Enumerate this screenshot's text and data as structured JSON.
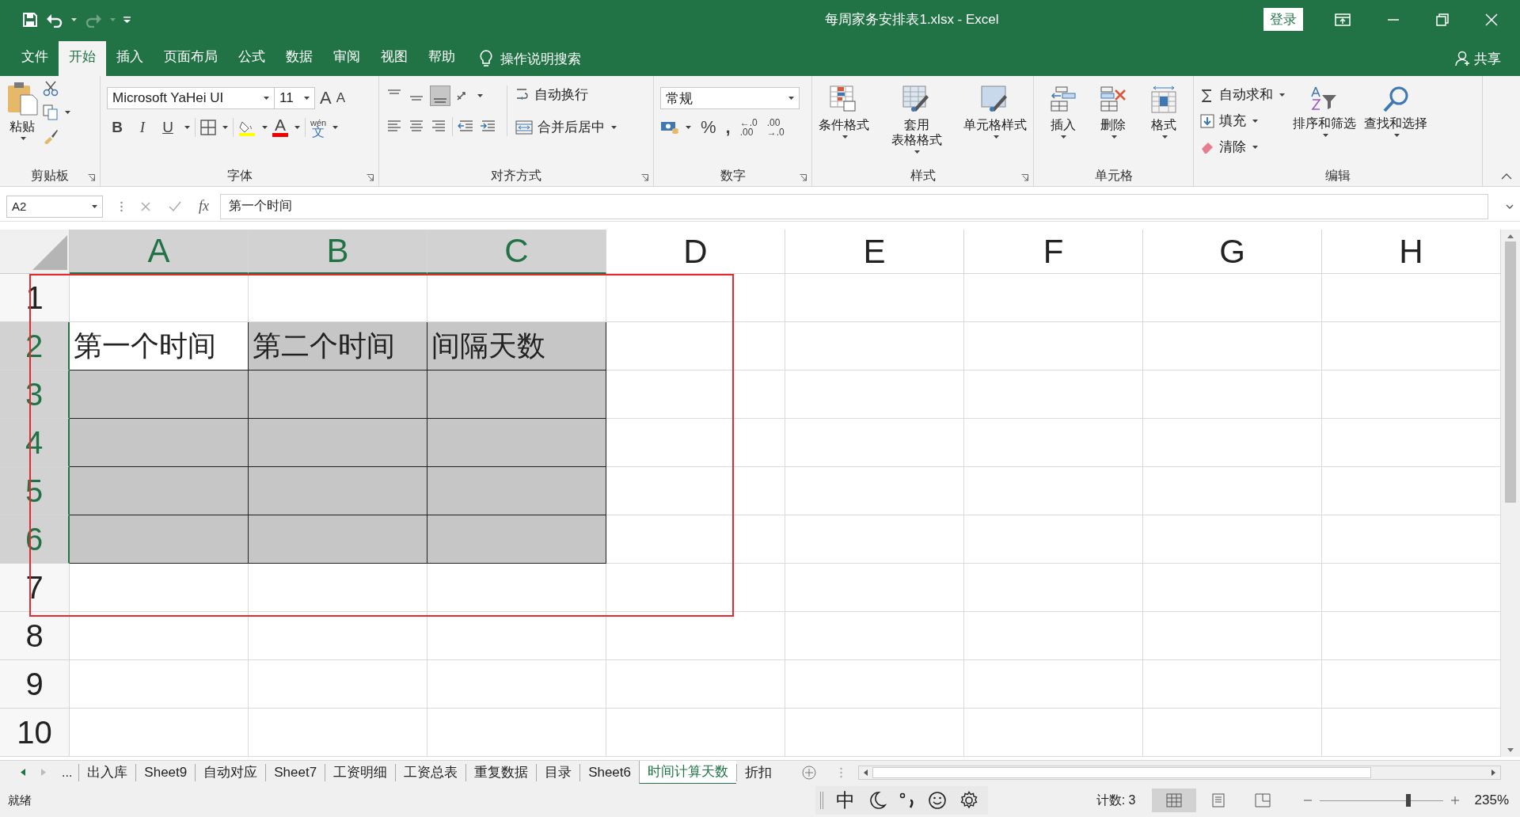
{
  "window": {
    "title": "每周家务安排表1.xlsx  -  Excel",
    "sign_in": "登录"
  },
  "ribbon_tabs": [
    {
      "label": "文件",
      "selected": false
    },
    {
      "label": "开始",
      "selected": true
    },
    {
      "label": "插入",
      "selected": false
    },
    {
      "label": "页面布局",
      "selected": false
    },
    {
      "label": "公式",
      "selected": false
    },
    {
      "label": "数据",
      "selected": false
    },
    {
      "label": "审阅",
      "selected": false
    },
    {
      "label": "视图",
      "selected": false
    },
    {
      "label": "帮助",
      "selected": false
    }
  ],
  "tell_me": "操作说明搜索",
  "share": "共享",
  "clipboard": {
    "label": "剪贴板",
    "paste": "粘贴"
  },
  "font": {
    "label": "字体",
    "name": "Microsoft YaHei UI",
    "size": "11",
    "grow_letter": "A",
    "shrink_letter": "A",
    "styles": [
      "B",
      "I",
      "U"
    ],
    "color_letter": "A",
    "phonetic_top": "wén",
    "phonetic_bottom": "文"
  },
  "alignment": {
    "label": "对齐方式",
    "wrap": "自动换行",
    "merge": "合并后居中"
  },
  "number": {
    "label": "数字",
    "format": "常规",
    "percent": "%",
    "comma": ",",
    "increase_decimal": [
      "←.0",
      ".00"
    ],
    "decrease_decimal": [
      ".00",
      "→.0"
    ]
  },
  "styles": {
    "label": "样式",
    "buttons": [
      [
        "条件格式"
      ],
      [
        "套用",
        "表格格式"
      ],
      [
        "单元格样式"
      ]
    ]
  },
  "cells_group": {
    "label": "单元格",
    "buttons": [
      "插入",
      "删除",
      "格式"
    ]
  },
  "editing": {
    "label": "编辑",
    "items": [
      "自动求和",
      "填充",
      "清除"
    ],
    "buttons": [
      "排序和筛选",
      "查找和选择"
    ]
  },
  "formula_bar": {
    "name_box": "A2",
    "fx": "fx",
    "formula": "第一个时间"
  },
  "sheet": {
    "columns": [
      {
        "label": "A",
        "selected": true
      },
      {
        "label": "B",
        "selected": true
      },
      {
        "label": "C",
        "selected": true
      },
      {
        "label": "D",
        "selected": false
      },
      {
        "label": "E",
        "selected": false
      },
      {
        "label": "F",
        "selected": false
      },
      {
        "label": "G",
        "selected": false
      },
      {
        "label": "H",
        "selected": false
      }
    ],
    "rows": [
      {
        "number": "1",
        "selected": false
      },
      {
        "number": "2",
        "selected": true,
        "cells": [
          {
            "text": "第一个时间",
            "active": true
          },
          {
            "text": "第二个时间",
            "active": false
          },
          {
            "text": "间隔天数",
            "active": false
          }
        ]
      },
      {
        "number": "3",
        "selected": true
      },
      {
        "number": "4",
        "selected": true
      },
      {
        "number": "5",
        "selected": true
      },
      {
        "number": "6",
        "selected": true
      },
      {
        "number": "7",
        "selected": false
      },
      {
        "number": "8",
        "selected": false
      },
      {
        "number": "9",
        "selected": false
      },
      {
        "number": "10",
        "selected": false
      }
    ],
    "highlight_frame": true
  },
  "sheet_tabs": {
    "more": "...",
    "tabs": [
      {
        "label": "出入库",
        "selected": false
      },
      {
        "label": "Sheet9",
        "selected": false
      },
      {
        "label": "自动对应",
        "selected": false
      },
      {
        "label": "Sheet7",
        "selected": false
      },
      {
        "label": "工资明细",
        "selected": false
      },
      {
        "label": "工资总表",
        "selected": false
      },
      {
        "label": "重复数据",
        "selected": false
      },
      {
        "label": "目录",
        "selected": false
      },
      {
        "label": "Sheet6",
        "selected": false
      },
      {
        "label": "时间计算天数",
        "selected": true
      },
      {
        "label": "折扣",
        "selected": false
      }
    ]
  },
  "status_bar": {
    "status": "就绪",
    "ime": "中",
    "count": "计数: 3",
    "zoom": {
      "level": 0.72,
      "reading": "235%"
    }
  }
}
